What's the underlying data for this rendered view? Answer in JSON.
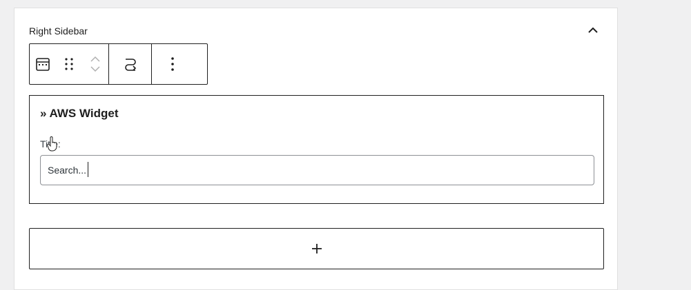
{
  "sidebar": {
    "title": "Right Sidebar",
    "collapse_icon": "chevron-up-icon"
  },
  "toolbar": {
    "block_icon": "calendar-icon",
    "drag_icon": "drag-handle-icon",
    "move_up_icon": "chevron-up-icon",
    "move_down_icon": "chevron-down-icon",
    "transform_icon": "transform-icon",
    "options_icon": "more-vertical-icon"
  },
  "widget": {
    "title": "» AWS Widget",
    "field_label": "Title:",
    "field_value": "Search..."
  },
  "add_block": {
    "icon": "plus-icon"
  },
  "colors": {
    "background": "#f0f0f1",
    "panel": "#ffffff",
    "border": "#1e1e1e",
    "input_border": "#8c8f94"
  }
}
